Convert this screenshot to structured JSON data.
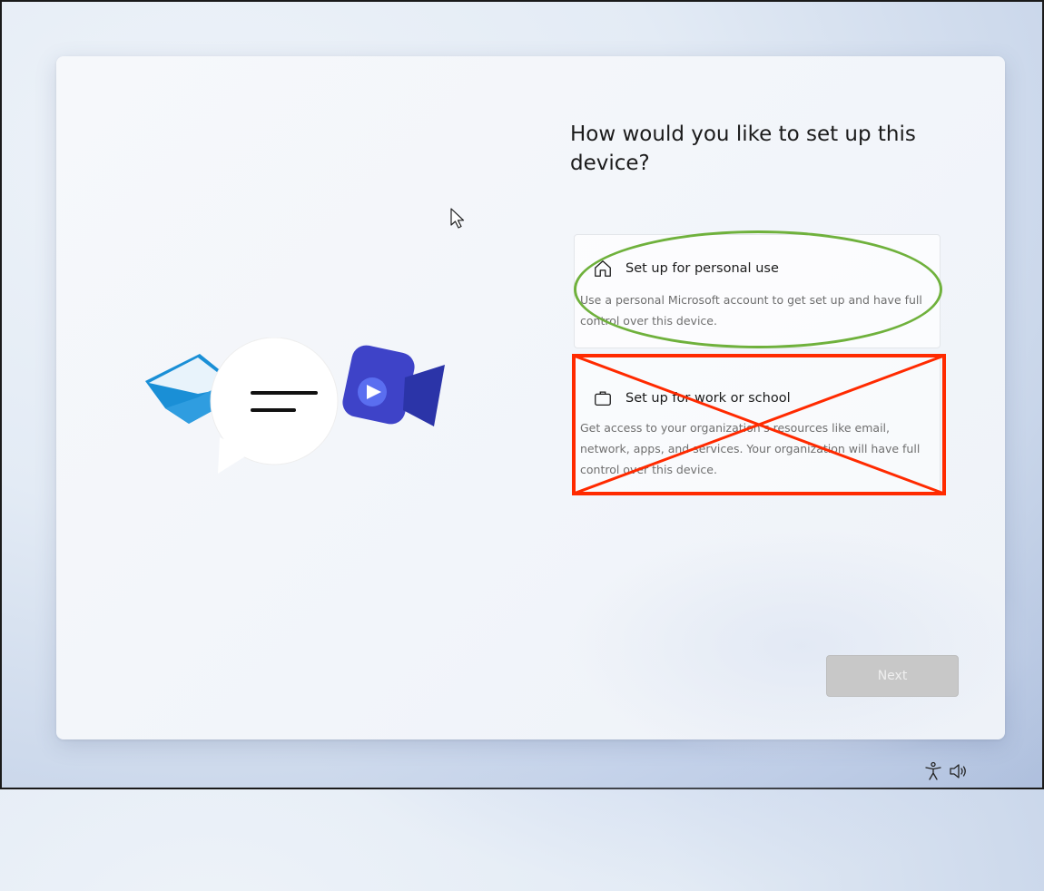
{
  "setup": {
    "title": "How would you like to set up this device?",
    "options": [
      {
        "label": "Set up for personal use",
        "description": "Use a personal Microsoft account to get set up and have full control over this device.",
        "icon": "home-icon"
      },
      {
        "label": "Set up for work or school",
        "description": "Get access to your organization's resources like email, network, apps, and services. Your organization will have full control over this device.",
        "icon": "briefcase-icon"
      }
    ],
    "next_label": "Next"
  },
  "annotations": {
    "ellipse_color": "#6fb13c",
    "cross_color": "#ff2a00"
  },
  "tray": {
    "icons": [
      "accessibility-icon",
      "volume-icon"
    ]
  }
}
